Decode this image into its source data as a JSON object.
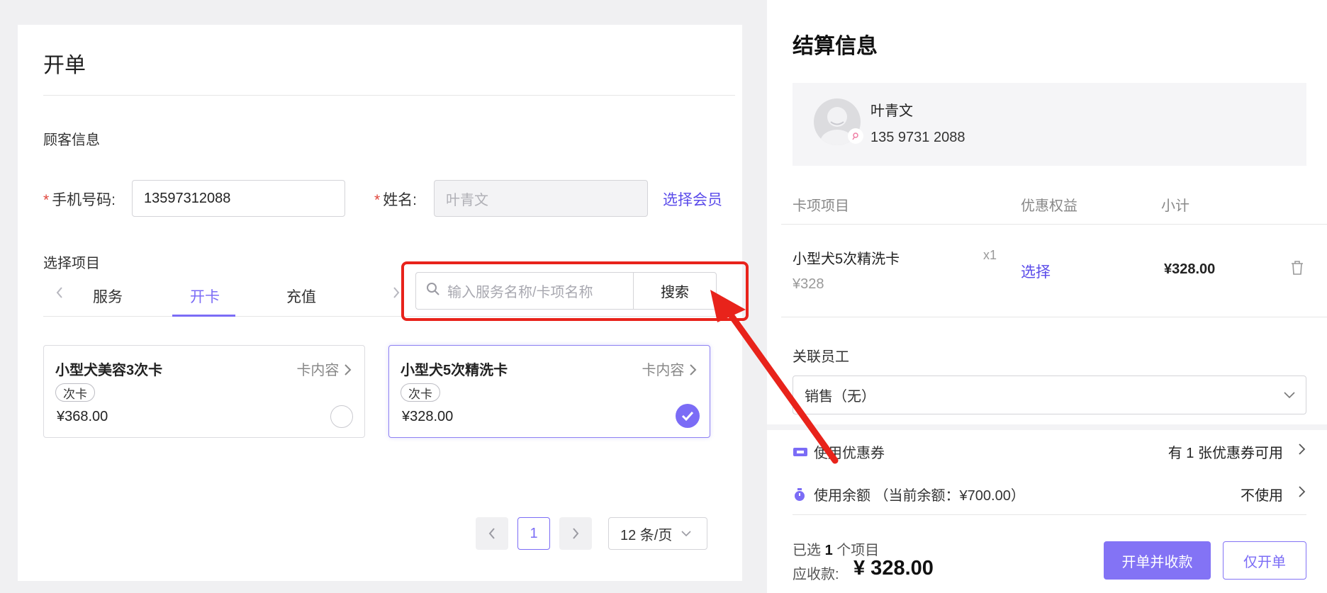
{
  "order": {
    "title": "开单",
    "customer_section": "顾客信息",
    "phone_label": "手机号码:",
    "phone_value": "13597312088",
    "name_label": "姓名:",
    "name_value": "叶青文",
    "select_member": "选择会员",
    "items_section": "选择项目",
    "tabs": [
      "服务",
      "开卡",
      "充值"
    ],
    "active_tab": "开卡",
    "search_placeholder": "输入服务名称/卡项名称",
    "search_button": "搜索",
    "cards": [
      {
        "title": "小型犬美容3次卡",
        "detail": "卡内容",
        "tag": "次卡",
        "price": "¥368.00",
        "selected": false
      },
      {
        "title": "小型犬5次精洗卡",
        "detail": "卡内容",
        "tag": "次卡",
        "price": "¥328.00",
        "selected": true
      }
    ],
    "pagination": {
      "current_page": "1",
      "page_size": "12 条/页"
    }
  },
  "checkout": {
    "title": "结算信息",
    "member": {
      "name": "叶青文",
      "phone": "135 9731 2088"
    },
    "columns": [
      "卡项项目",
      "优惠权益",
      "小计"
    ],
    "item": {
      "name": "小型犬5次精洗卡",
      "qty": "x1",
      "original_price": "¥328",
      "benefit": "选择",
      "subtotal": "¥328.00"
    },
    "staff_label": "关联员工",
    "staff_value": "销售（无）",
    "coupon_label": "使用优惠券",
    "coupon_value": "有 1 张优惠券可用",
    "balance_label": "使用余额 （当前余额：¥700.00）",
    "balance_value": "不使用",
    "selected_prefix": "已选",
    "selected_count": "1",
    "selected_suffix": "个项目",
    "amount_label": "应收款:",
    "amount_value": "¥ 328.00",
    "btn_order_and_collect": "开单并收款",
    "btn_order_only": "仅开单"
  },
  "colors": {
    "accent": "#7b6cf6",
    "highlight": "#e8231b",
    "link": "#5a4bea"
  },
  "icons": [
    "search-icon",
    "chevron-left-icon",
    "chevron-right-icon",
    "check-icon",
    "trash-icon",
    "chevron-down-icon",
    "coupon-icon",
    "balance-icon",
    "avatar-icon"
  ]
}
